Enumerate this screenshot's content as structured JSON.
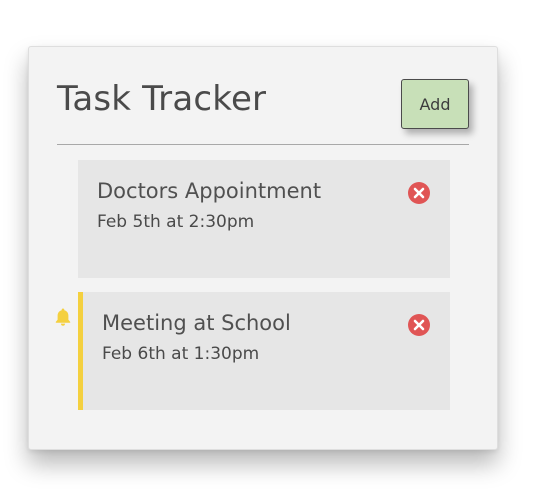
{
  "header": {
    "title": "Task Tracker",
    "add_button_label": "Add"
  },
  "tasks": [
    {
      "title": "Doctors Appointment",
      "date": "Feb 5th at 2:30pm",
      "reminder": false
    },
    {
      "title": "Meeting at School",
      "date": "Feb 6th at 1:30pm",
      "reminder": true
    }
  ],
  "icons": {
    "delete": "delete-icon",
    "reminder": "bell-icon"
  },
  "colors": {
    "reminder_accent": "#f4d03f",
    "delete": "#e05555",
    "add_button_bg": "#c8e0b8",
    "task_bg": "#e6e6e6",
    "card_bg": "#f3f3f3"
  }
}
